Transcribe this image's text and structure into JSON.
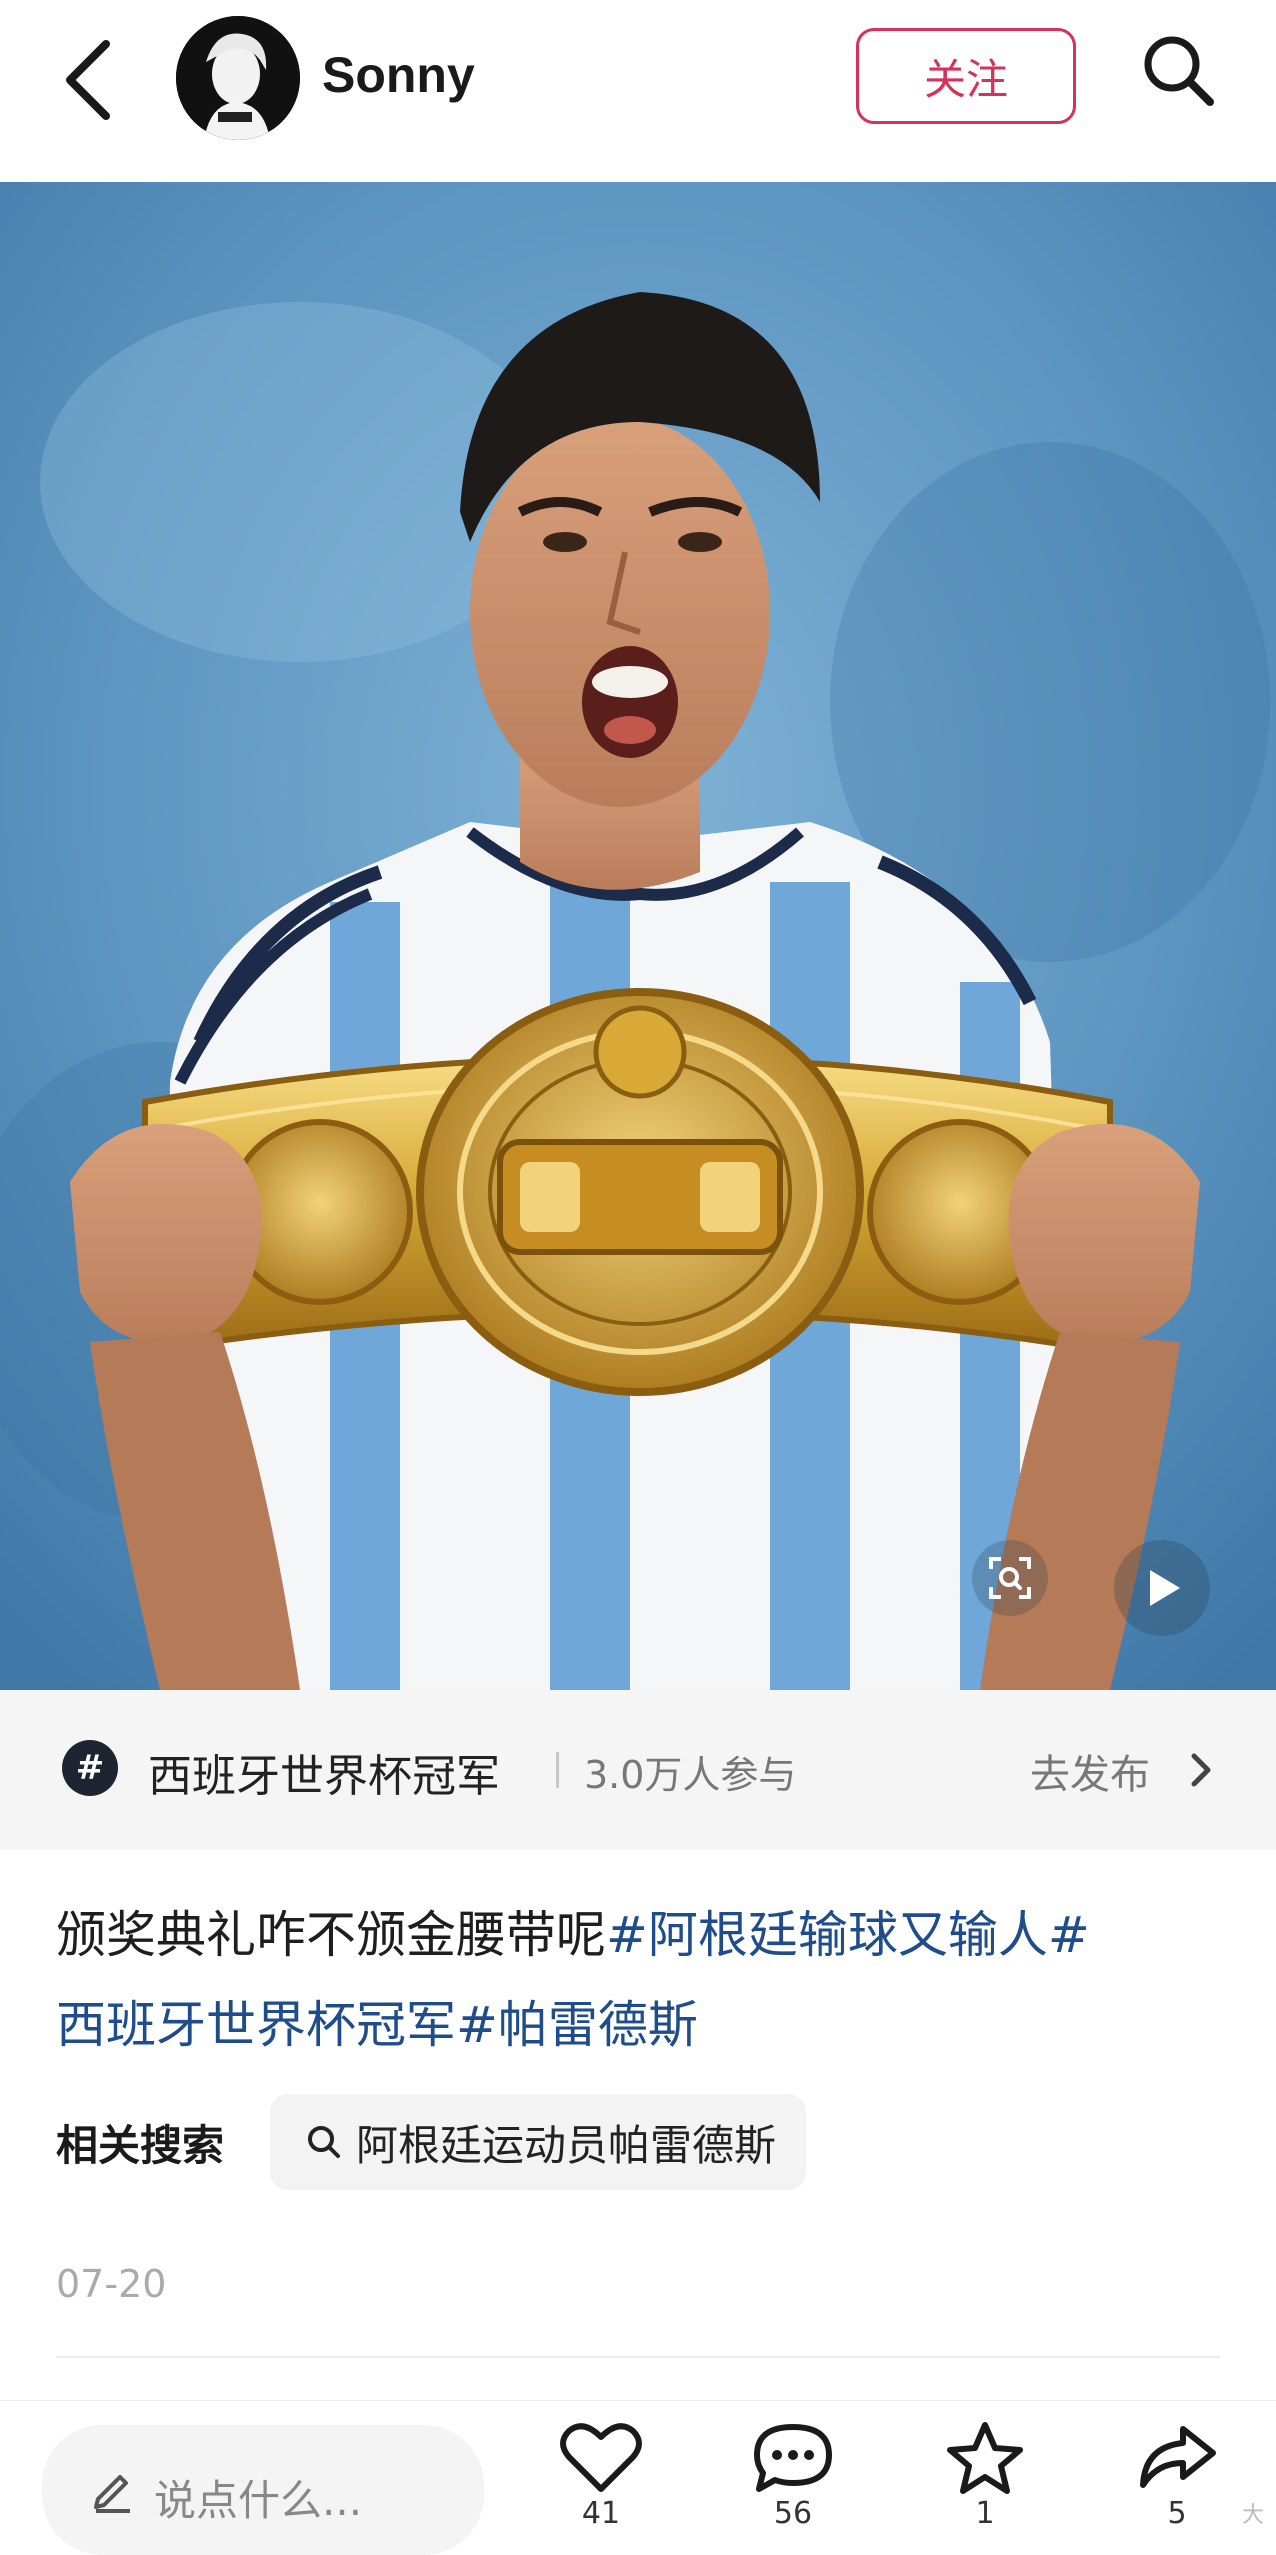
{
  "header": {
    "back_icon": "chevron-left-icon",
    "username": "Sonny",
    "follow_label": "关注",
    "search_icon": "search-icon",
    "accent_color": "#d6315a"
  },
  "media": {
    "scan_icon": "image-scan-icon",
    "play_icon": "play-icon"
  },
  "topic": {
    "icon_label": "#",
    "title": "西班牙世界杯冠军",
    "participants": "3.0万人参与",
    "action_label": "去发布"
  },
  "post": {
    "text": "颁奖典礼咋不颁金腰带呢",
    "hashtags": [
      "#阿根廷输球又输人#",
      "西班牙世界杯冠军#",
      "帕雷德斯"
    ],
    "hashtag_color": "#1f4d8c",
    "related_label": "相关搜索",
    "related_query": "阿根廷运动员帕雷德斯",
    "date": "07-20"
  },
  "bottom_bar": {
    "comment_placeholder": "说点什么...",
    "like_count": "41",
    "comment_count": "56",
    "favorite_count": "1",
    "share_count": "5",
    "watermark": "大"
  }
}
